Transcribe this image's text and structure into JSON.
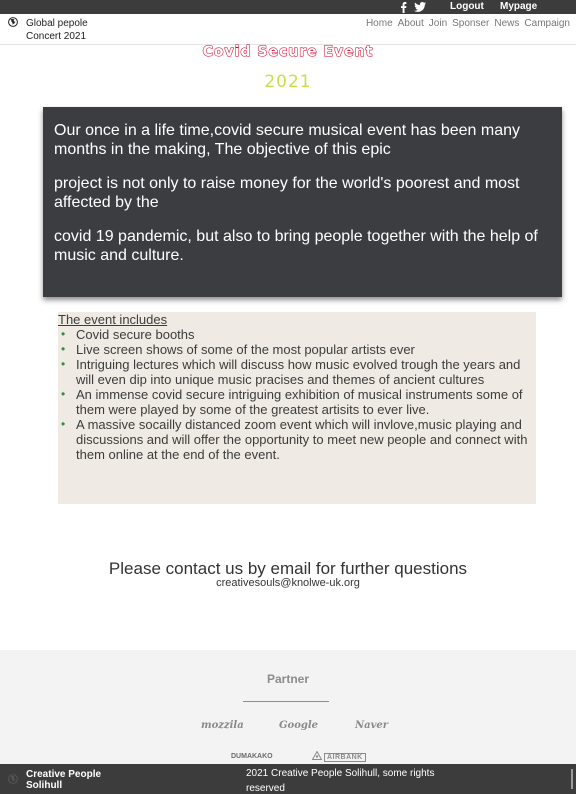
{
  "topbar": {
    "icons": [
      "facebook-icon",
      "twitter-icon"
    ],
    "logout_label": "Logout",
    "mypage_label": "Mypage"
  },
  "header": {
    "brand_icon": "globe-icon",
    "brand": "Global pepole Concert 2021",
    "nav": [
      "Home",
      "About",
      "Join",
      "Sponser",
      "News",
      "Campaign"
    ]
  },
  "hero": {
    "title": "Covid Secure Event",
    "year": "2021",
    "title_color": "#d5002a",
    "year_color": "#c5e14a"
  },
  "intro": {
    "paragraphs": [
      "Our once in a life time,covid secure musical event has been many months in the making, The objective of this epic",
      "project is not only to raise money for the world's poorest and most affected by the",
      "covid 19 pandemic, but also to bring people together with the help of music and culture."
    ]
  },
  "includes": {
    "heading": "The event includes",
    "items": [
      "Covid secure booths",
      "Live screen shows of some of the most popular artists ever",
      "Intriguing lectures which will discuss how music evolved trough the years and will even dip into unique music pracises and themes of ancient cultures",
      "An immense covid secure intriguing exhibition of musical instruments some of them were played by some of the greatest artisits to ever live.",
      "A massive socailly distanced zoom event which will invlove,music playing and discussions and will offer the opportunity to meet new people and connect with them online at the end of the event."
    ]
  },
  "contact": {
    "title": "Please contact us by email for further questions",
    "email": "creativesouls@knolwe-uk.org"
  },
  "partner": {
    "title": "Partner",
    "logos": [
      "mozzila",
      "Google",
      "Naver",
      "DUMAKAKO",
      "AIRBANK"
    ]
  },
  "footer": {
    "icon": "globe-icon",
    "brand": "Creative People Solihull",
    "copyright": "2021 Creative People Solihull, some rights reserved"
  }
}
